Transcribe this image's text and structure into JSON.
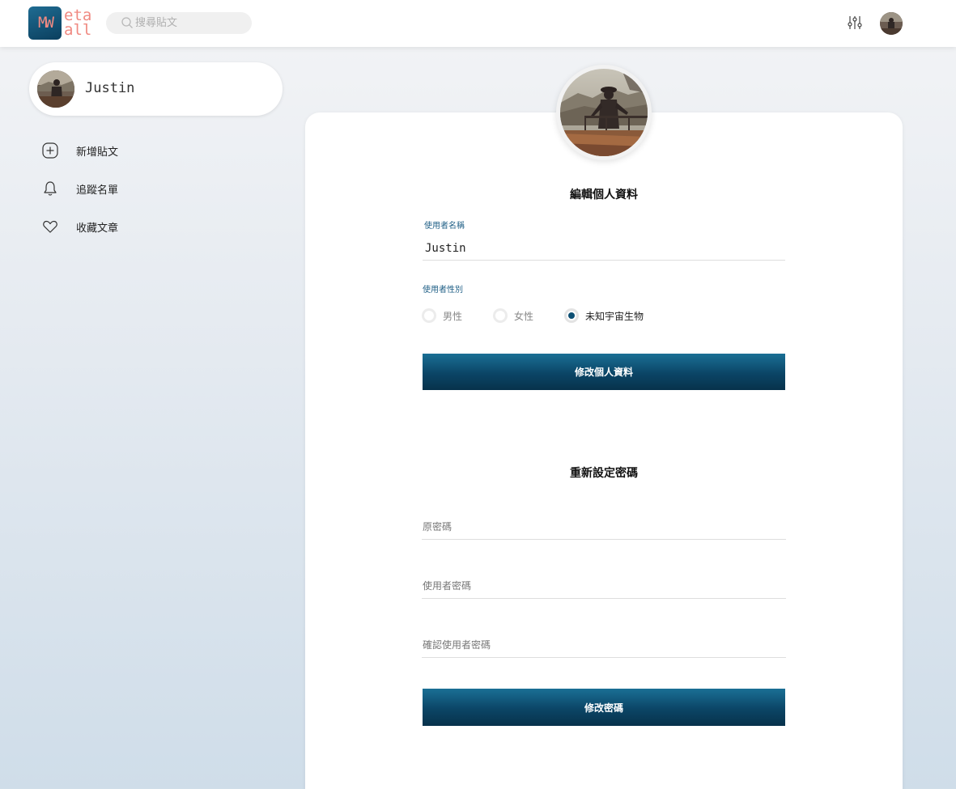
{
  "header": {
    "logo_mark": "MW",
    "logo_line1": "eta",
    "logo_line2": "all",
    "search_placeholder": "搜尋貼文"
  },
  "sidebar": {
    "profile_name": "Justin",
    "items": [
      {
        "label": "新增貼文",
        "icon": "plus-square-icon"
      },
      {
        "label": "追蹤名單",
        "icon": "bell-icon"
      },
      {
        "label": "收藏文章",
        "icon": "heart-icon"
      }
    ]
  },
  "profile_form": {
    "title": "編輯個人資料",
    "username_label": "使用者名稱",
    "username_value": "Justin",
    "gender_label": "使用者性別",
    "gender_options": [
      "男性",
      "女性",
      "未知宇宙生物"
    ],
    "gender_selected": "未知宇宙生物",
    "submit_label": "修改個人資料"
  },
  "password_form": {
    "title": "重新設定密碼",
    "old_password_placeholder": "原密碼",
    "new_password_placeholder": "使用者密碼",
    "confirm_password_placeholder": "確認使用者密碼",
    "submit_label": "修改密碼"
  },
  "colors": {
    "accent": "#0d4f73",
    "logo_text": "#f08a82"
  }
}
